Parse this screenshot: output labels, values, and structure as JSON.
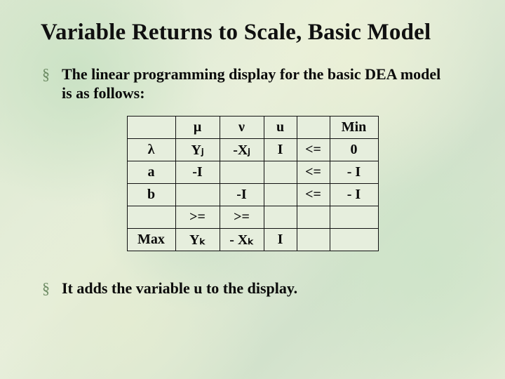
{
  "title": "Variable Returns to Scale, Basic Model",
  "bullets": {
    "b1": "The linear programming display for the basic DEA model is as follows:",
    "b2": "It adds the variable u to the display."
  },
  "table": {
    "r0": {
      "c0": "",
      "c1": "μ",
      "c2": "ν",
      "c3": "u",
      "c4": "",
      "c5": "Min"
    },
    "r1": {
      "c0": "λ",
      "c1": "Yⱼ",
      "c2": "-Xⱼ",
      "c3": "I",
      "c4": "<=",
      "c5": "0"
    },
    "r2": {
      "c0": "a",
      "c1": "-I",
      "c2": "",
      "c3": "",
      "c4": "<=",
      "c5": "- I"
    },
    "r3": {
      "c0": "b",
      "c1": "",
      "c2": "-I",
      "c3": "",
      "c4": "<=",
      "c5": "- I"
    },
    "r4": {
      "c0": "",
      "c1": ">=",
      "c2": ">=",
      "c3": "",
      "c4": "",
      "c5": ""
    },
    "r5": {
      "c0": "Max",
      "c1": "Yₖ",
      "c2": "- Xₖ",
      "c3": "I",
      "c4": "",
      "c5": ""
    }
  }
}
